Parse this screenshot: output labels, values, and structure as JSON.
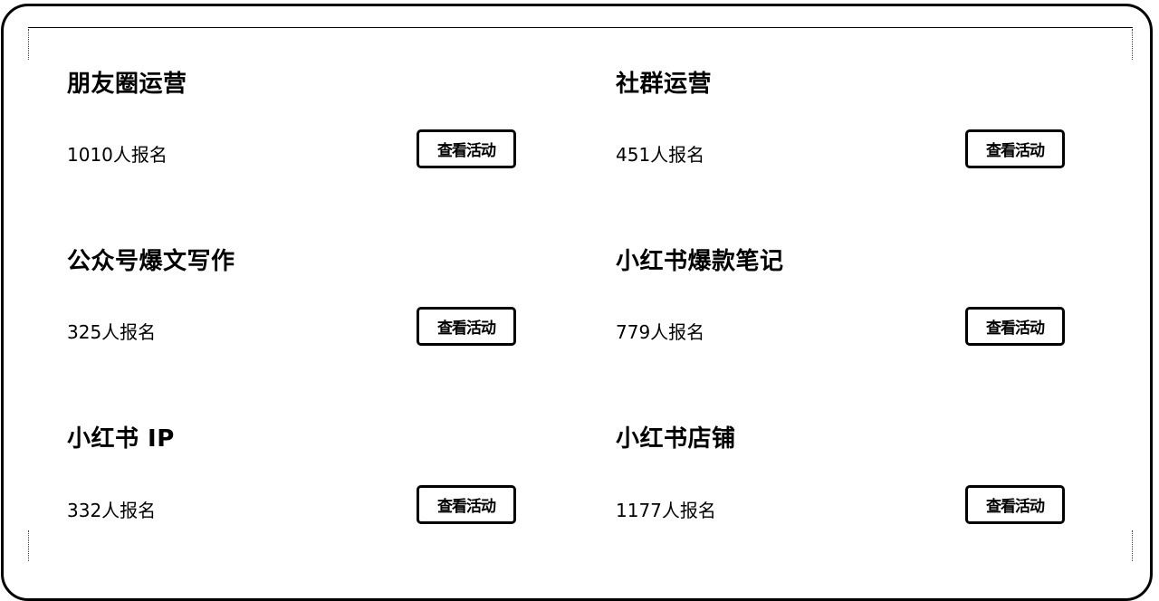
{
  "activities": [
    {
      "title": "朋友圈运营",
      "count": "1010人报名",
      "button": "查看活动"
    },
    {
      "title": "社群运营",
      "count": "451人报名",
      "button": "查看活动"
    },
    {
      "title": "公众号爆文写作",
      "count": "325人报名",
      "button": "查看活动"
    },
    {
      "title": "小红书爆款笔记",
      "count": "779人报名",
      "button": "查看活动"
    },
    {
      "title": "小红书 IP",
      "count": "332人报名",
      "button": "查看活动"
    },
    {
      "title": "小红书店铺",
      "count": "1177人报名",
      "button": "查看活动"
    }
  ]
}
